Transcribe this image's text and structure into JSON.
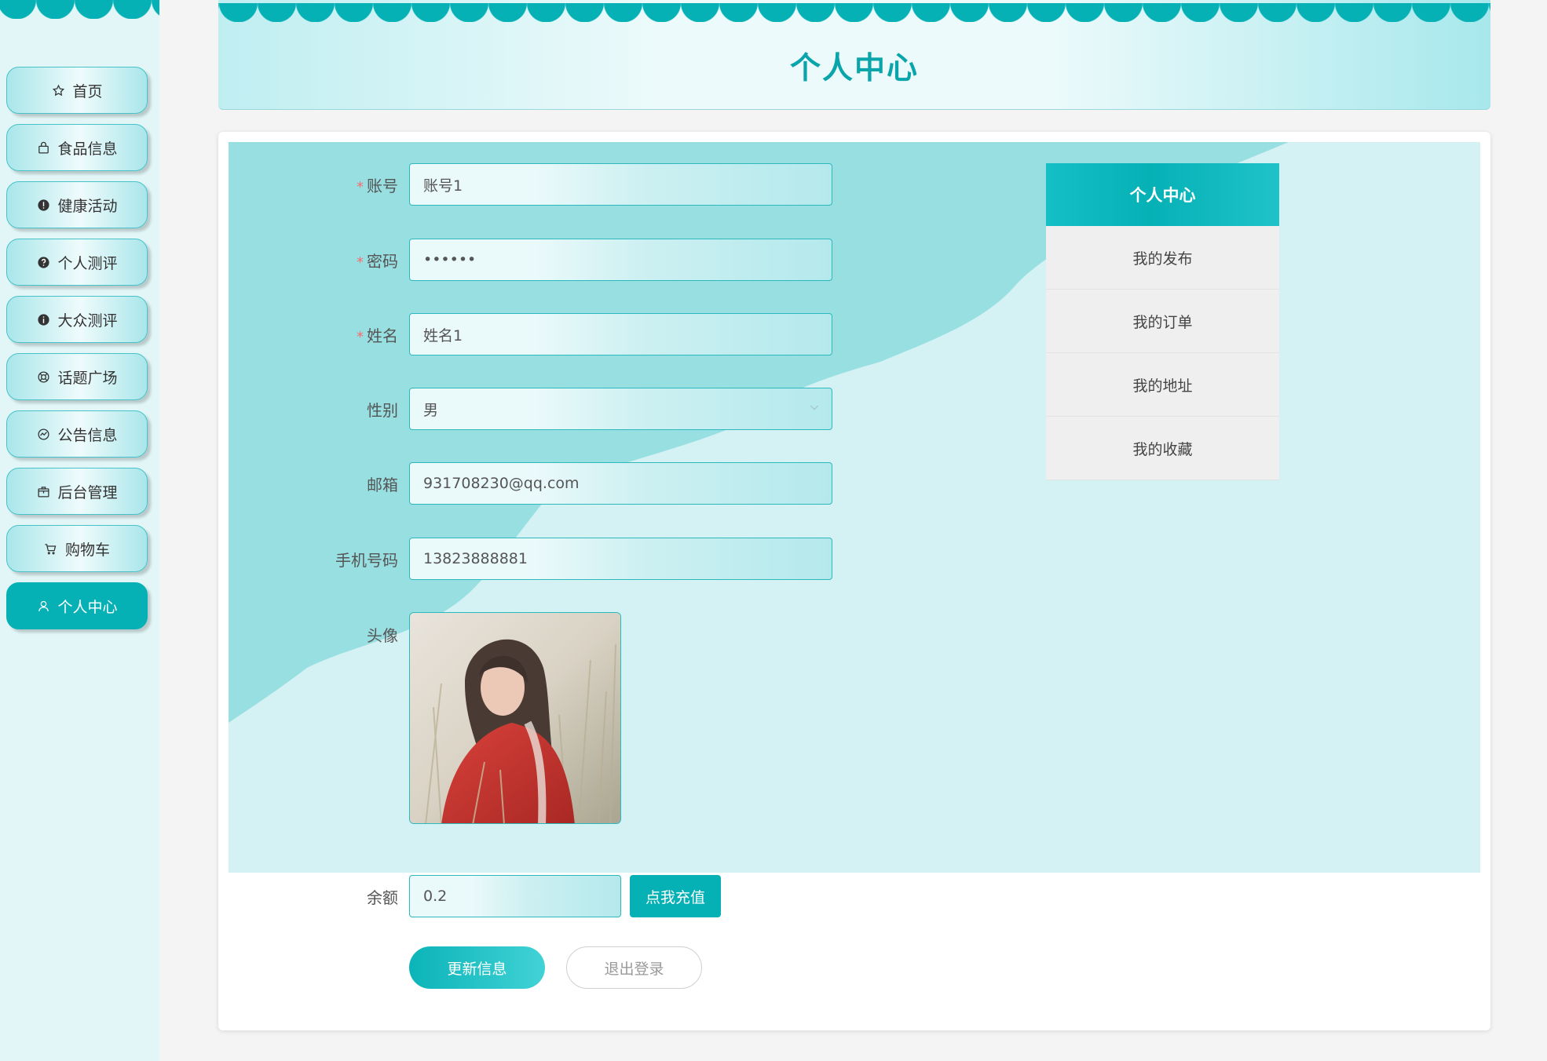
{
  "sidebar": {
    "items": [
      {
        "label": "首页",
        "icon": "star-icon"
      },
      {
        "label": "食品信息",
        "icon": "bag-icon"
      },
      {
        "label": "健康活动",
        "icon": "exclamation-circle-icon"
      },
      {
        "label": "个人测评",
        "icon": "question-circle-icon"
      },
      {
        "label": "大众测评",
        "icon": "info-circle-icon"
      },
      {
        "label": "话题广场",
        "icon": "lifebuoy-icon"
      },
      {
        "label": "公告信息",
        "icon": "chart-circle-icon"
      },
      {
        "label": "后台管理",
        "icon": "box-icon"
      },
      {
        "label": "购物车",
        "icon": "cart-icon"
      },
      {
        "label": "个人中心",
        "icon": "user-icon",
        "active": true
      }
    ]
  },
  "header": {
    "title": "个人中心"
  },
  "form": {
    "account": {
      "label": "账号",
      "value": "账号1",
      "required": true
    },
    "password": {
      "label": "密码",
      "value": "••••••",
      "required": true
    },
    "name": {
      "label": "姓名",
      "value": "姓名1",
      "required": true
    },
    "gender": {
      "label": "性别",
      "value": "男"
    },
    "email": {
      "label": "邮箱",
      "value": "931708230@qq.com"
    },
    "phone": {
      "label": "手机号码",
      "value": "13823888881"
    },
    "avatar": {
      "label": "头像"
    },
    "balance": {
      "label": "余额",
      "value": "0.2"
    },
    "recharge_label": "点我充值",
    "update_label": "更新信息",
    "logout_label": "退出登录"
  },
  "side_menu": {
    "title": "个人中心",
    "items": [
      "我的发布",
      "我的订单",
      "我的地址",
      "我的收藏"
    ]
  },
  "colors": {
    "accent": "#06b1b6",
    "panel": "#d4f1f3",
    "wave": "#98dfe2"
  }
}
